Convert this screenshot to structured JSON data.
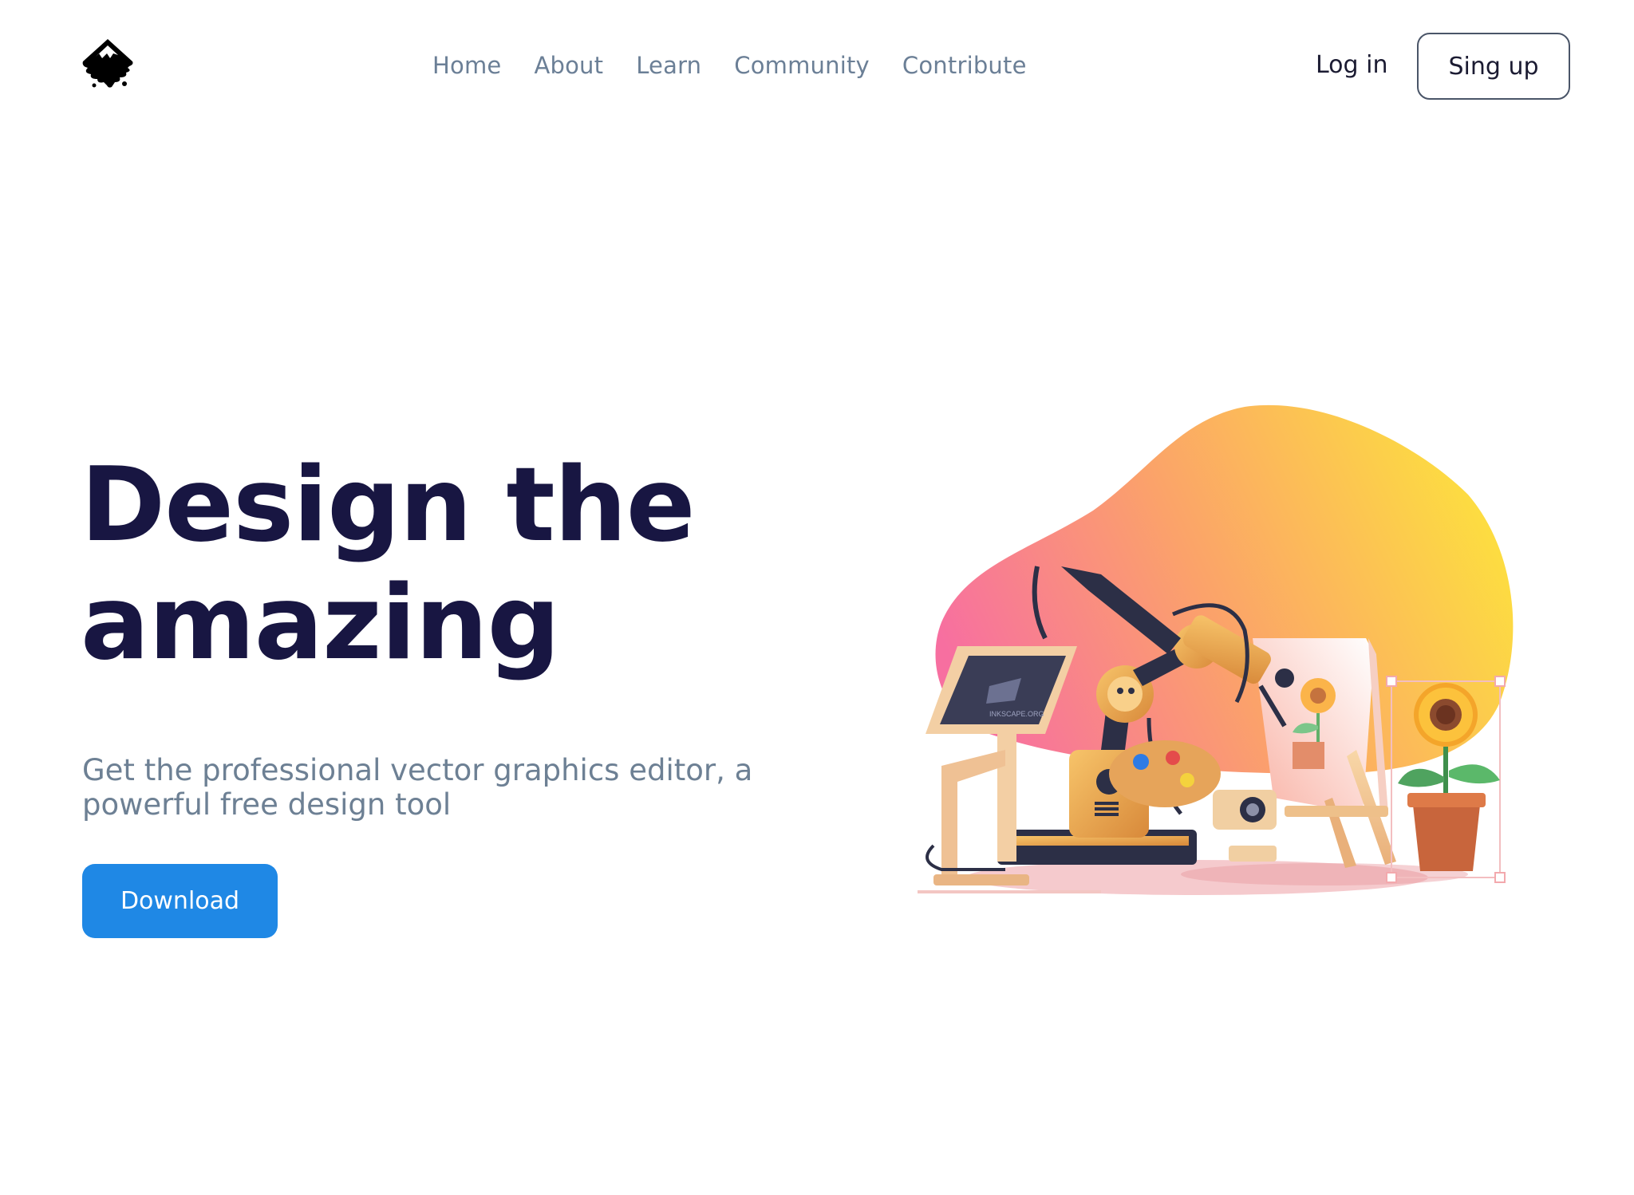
{
  "header": {
    "logo_icon": "inkscape-logo-icon",
    "nav": [
      {
        "label": "Home"
      },
      {
        "label": "About"
      },
      {
        "label": "Learn"
      },
      {
        "label": "Community"
      },
      {
        "label": "Contribute"
      }
    ],
    "login_label": "Log in",
    "signup_label": "Sing up"
  },
  "hero": {
    "title_line1": "Design the",
    "title_line2": "amazing",
    "subtitle": "Get the professional vector graphics editor, a powerful free design tool",
    "download_label": "Download",
    "illustration_icon": "robot-painting-illustration",
    "monitor_text": "INKSCAPE.ORG"
  },
  "colors": {
    "title": "#181642",
    "muted": "#6b7f96",
    "accent": "#1f88e5",
    "blob_start": "#f76fa0",
    "blob_end": "#fde23d"
  }
}
